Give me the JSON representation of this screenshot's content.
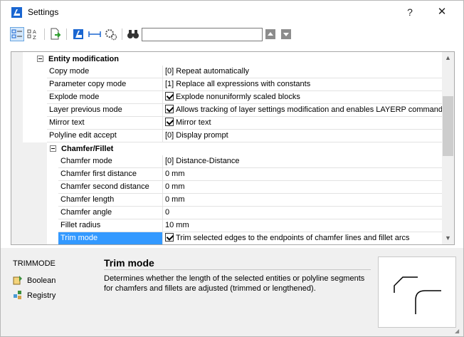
{
  "window": {
    "title": "Settings",
    "help_label": "?",
    "close_label": "✕"
  },
  "toolbar": {
    "tools": [
      "categorized-view",
      "alphabetical-view",
      "export-settings",
      "program-settings",
      "drawing-settings",
      "user-settings",
      "find"
    ],
    "search_value": "",
    "search_placeholder": ""
  },
  "grid": {
    "section": "Entity modification",
    "rows": [
      {
        "name": "Copy mode",
        "value": "[0] Repeat automatically",
        "checkbox": false
      },
      {
        "name": "Parameter copy mode",
        "value": "[1] Replace all expressions with constants",
        "checkbox": false
      },
      {
        "name": "Explode mode",
        "value": "Explode nonuniformly scaled blocks",
        "checkbox": true
      },
      {
        "name": "Layer previous mode",
        "value": "Allows tracking of layer settings modification and enables LAYERP command.",
        "checkbox": true
      },
      {
        "name": "Mirror text",
        "value": "Mirror text",
        "checkbox": true
      },
      {
        "name": "Polyline edit accept",
        "value": "[0] Display prompt",
        "checkbox": false
      }
    ],
    "subsection": "Chamfer/Fillet",
    "subrows": [
      {
        "name": "Chamfer mode",
        "value": "[0] Distance-Distance",
        "checkbox": false
      },
      {
        "name": "Chamfer first distance",
        "value": "0 mm",
        "checkbox": false
      },
      {
        "name": "Chamfer second distance",
        "value": "0 mm",
        "checkbox": false
      },
      {
        "name": "Chamfer length",
        "value": "0 mm",
        "checkbox": false
      },
      {
        "name": "Chamfer angle",
        "value": "0",
        "checkbox": false
      },
      {
        "name": "Fillet radius",
        "value": "10 mm",
        "checkbox": false
      },
      {
        "name": "Trim mode",
        "value": "Trim selected edges to the endpoints of chamfer lines and fillet arcs",
        "checkbox": true,
        "selected": true
      }
    ]
  },
  "info": {
    "variable": "TRIMMODE",
    "links": [
      "Boolean",
      "Registry"
    ],
    "title": "Trim mode",
    "description": "Determines whether the length of the selected entities or polyline segments for chamfers and fillets are adjusted (trimmed or lengthened)."
  },
  "colors": {
    "selection": "#3399ff",
    "accent": "#1a66d1"
  }
}
